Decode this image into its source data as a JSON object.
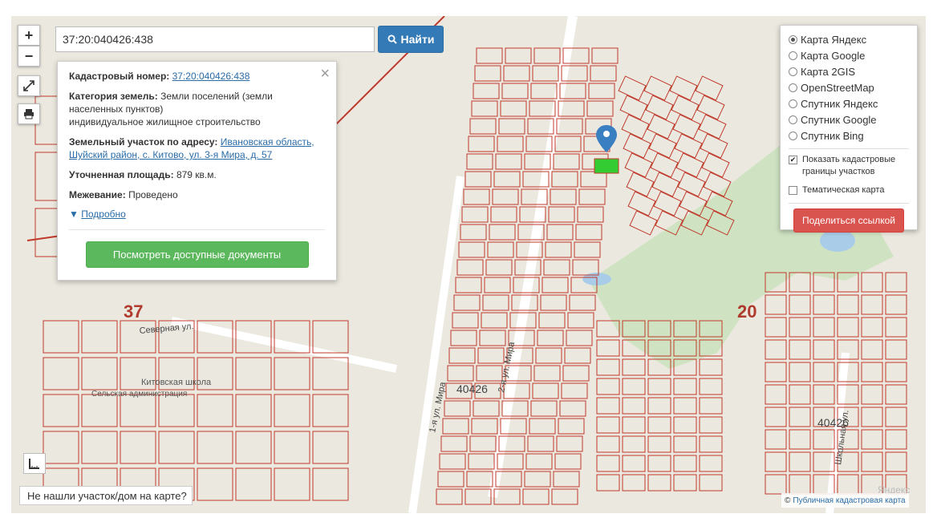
{
  "search": {
    "value": "37:20:040426:438",
    "button_label": "Найти"
  },
  "zoom": {
    "in_label": "+",
    "out_label": "−"
  },
  "info_panel": {
    "cadastral_label": "Кадастровый номер:",
    "cadastral_value": "37:20:040426:438",
    "category_label": "Категория земель:",
    "category_value": "Земли поселений (земли населенных пунктов)",
    "category_use": "индивидуальное жилищное строительство",
    "address_label": "Земельный участок по адресу:",
    "address_value": "Ивановская область, Шуйский район, с. Китово, ул. 3-я Мира, д. 57",
    "area_label": "Уточненная площадь:",
    "area_value": "879 кв.м.",
    "survey_label": "Межевание:",
    "survey_value": "Проведено",
    "more_label": "Подробно",
    "docs_button": "Посмотреть доступные документы",
    "close_glyph": "×"
  },
  "layers": {
    "options": [
      "Карта Яндекс",
      "Карта Google",
      "Карта 2GIS",
      "OpenStreetMap",
      "Спутник Яндекс",
      "Спутник Google",
      "Спутник Bing"
    ],
    "selected": "Карта Яндекс",
    "show_borders_label": "Показать кадастровые границы участков",
    "show_borders_checked": true,
    "thematic_label": "Тематическая карта",
    "thematic_checked": false,
    "share_button": "Поделиться ссылкой"
  },
  "not_found_label": "Не нашли участок/дом на карте?",
  "attribution": {
    "prefix": "©",
    "link": "Публичная кадастровая карта"
  },
  "map_labels": {
    "quarter_37": "37",
    "quarter_20": "20",
    "block_40426_a": "40426",
    "block_40426_b": "40426",
    "street_severnaya": "Северная ул.",
    "street_mira_1": "1-я ул. Мира",
    "street_mira_2": "2-я ул. Мира",
    "street_shkolnaya": "Школьная ул.",
    "school": "Китовская школа",
    "admin": "Сельская администрация",
    "yandex": "Яндекс"
  },
  "colors": {
    "parcel_line": "#c0392b",
    "selected_parcel": "#33cc33",
    "pin": "#3a7fc1",
    "forest": "#cfe3c2",
    "water": "#a9cde8"
  }
}
